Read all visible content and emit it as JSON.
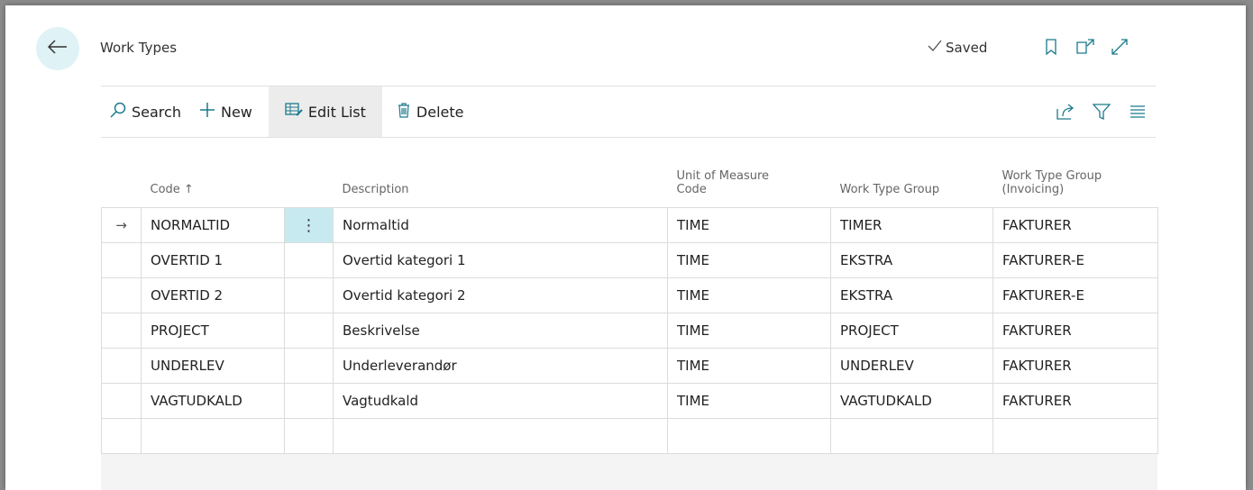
{
  "page": {
    "title": "Work Types",
    "status": "Saved"
  },
  "actions": {
    "search": "Search",
    "new": "New",
    "edit_list": "Edit List",
    "delete": "Delete"
  },
  "icons": {
    "back": "back-arrow-icon",
    "saved": "checkmark-icon",
    "bookmark": "bookmark-icon",
    "open_new": "open-new-window-icon",
    "expand": "expand-icon",
    "share": "share-icon",
    "filter": "filter-icon",
    "list": "list-view-icon"
  },
  "columns": {
    "code": "Code ↑",
    "description": "Description",
    "uom_line1": "Unit of Measure",
    "uom_line2": "Code",
    "work_type_group": "Work Type Group",
    "wtg_inv_line1": "Work Type Group",
    "wtg_inv_line2": "(Invoicing)"
  },
  "rows": [
    {
      "indicator": "→",
      "code": "NORMALTID",
      "description": "Normaltid",
      "uom": "TIME",
      "group": "TIMER",
      "group_inv": "FAKTURER"
    },
    {
      "indicator": "",
      "code": "OVERTID 1",
      "description": "Overtid kategori 1",
      "uom": "TIME",
      "group": "EKSTRA",
      "group_inv": "FAKTURER-E"
    },
    {
      "indicator": "",
      "code": "OVERTID 2",
      "description": "Overtid kategori 2",
      "uom": "TIME",
      "group": "EKSTRA",
      "group_inv": "FAKTURER-E"
    },
    {
      "indicator": "",
      "code": "PROJECT",
      "description": "Beskrivelse",
      "uom": "TIME",
      "group": "PROJECT",
      "group_inv": "FAKTURER"
    },
    {
      "indicator": "",
      "code": "UNDERLEV",
      "description": "Underleverandør",
      "uom": "TIME",
      "group": "UNDERLEV",
      "group_inv": "FAKTURER"
    },
    {
      "indicator": "",
      "code": "VAGTUDKALD",
      "description": "Vagtudkald",
      "uom": "TIME",
      "group": "VAGTUDKALD",
      "group_inv": "FAKTURER"
    },
    {
      "indicator": "",
      "code": "",
      "description": "",
      "uom": "",
      "group": "",
      "group_inv": ""
    }
  ],
  "colors": {
    "accent": "#c7eaf0",
    "back_button_bg": "#dff2f5",
    "edit_list_active": "#ececec"
  }
}
